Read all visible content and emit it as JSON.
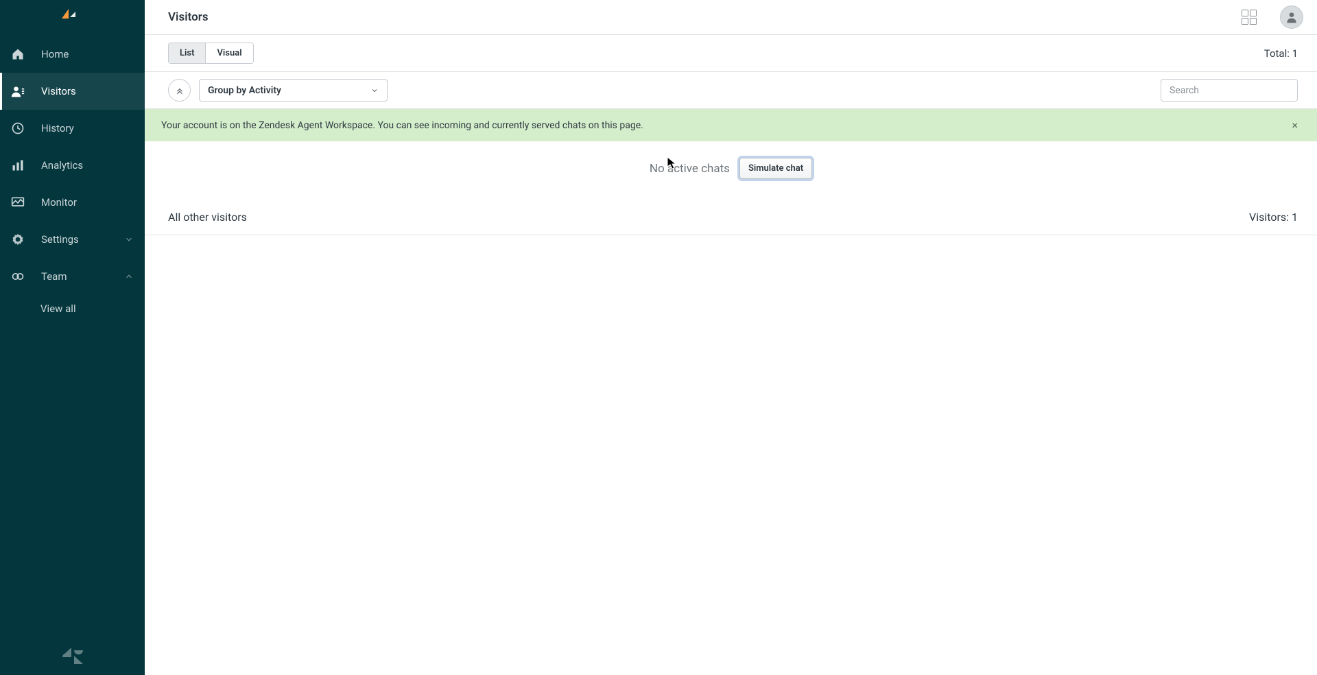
{
  "sidebar": {
    "items": [
      {
        "label": "Home"
      },
      {
        "label": "Visitors"
      },
      {
        "label": "History"
      },
      {
        "label": "Analytics"
      },
      {
        "label": "Monitor"
      },
      {
        "label": "Settings"
      },
      {
        "label": "Team"
      }
    ],
    "subitems": {
      "team": [
        {
          "label": "View all"
        }
      ]
    }
  },
  "header": {
    "title": "Visitors"
  },
  "toolbar": {
    "list_label": "List",
    "visual_label": "Visual",
    "total_label": "Total: 1",
    "group_by_label": "Group by Activity",
    "search_placeholder": "Search"
  },
  "banner": {
    "text": "Your account is on the Zendesk Agent Workspace. You can see incoming and currently served chats on this page."
  },
  "main": {
    "no_chats_label": "No active chats",
    "simulate_label": "Simulate chat",
    "other_visitors_label": "All other visitors",
    "other_visitors_count_label": "Visitors: 1"
  }
}
